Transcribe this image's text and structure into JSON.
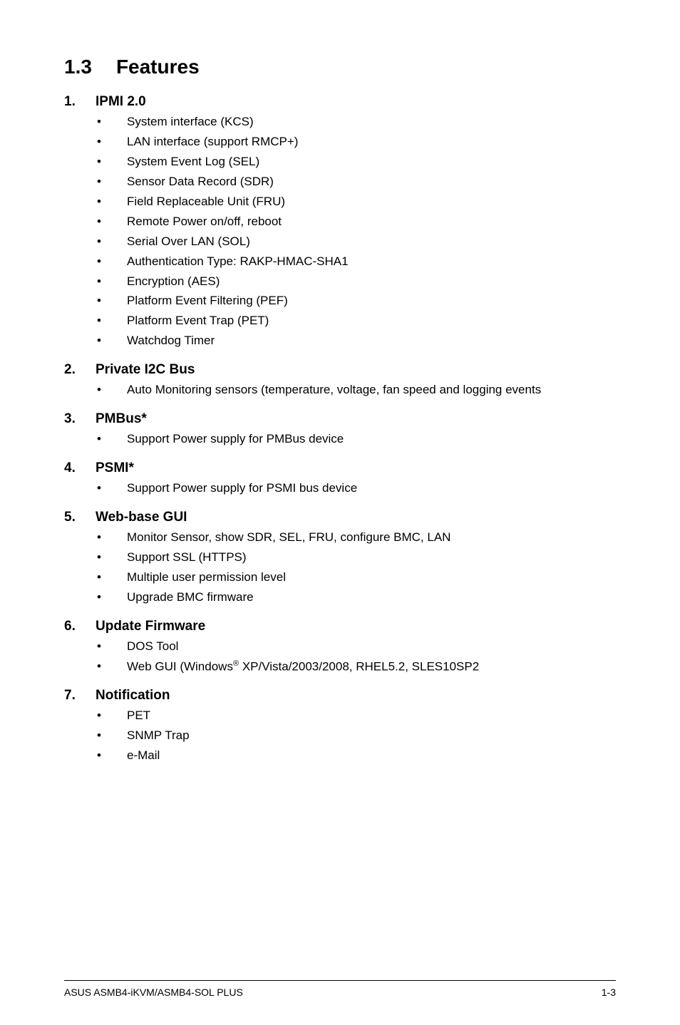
{
  "section": {
    "number": "1.3",
    "title": "Features"
  },
  "items": [
    {
      "num": "1.",
      "title": "IPMI 2.0",
      "subs": [
        "System interface (KCS)",
        "LAN interface (support RMCP+)",
        "System Event Log (SEL)",
        "Sensor Data Record (SDR)",
        "Field Replaceable Unit (FRU)",
        "Remote Power on/off, reboot",
        "Serial Over LAN (SOL)",
        "Authentication Type: RAKP-HMAC-SHA1",
        "Encryption (AES)",
        "Platform Event Filtering (PEF)",
        "Platform Event Trap (PET)",
        "Watchdog Timer"
      ]
    },
    {
      "num": "2.",
      "title": "Private I2C Bus",
      "subs": [
        "Auto Monitoring sensors (temperature, voltage, fan speed and logging events"
      ]
    },
    {
      "num": "3.",
      "title": "PMBus*",
      "subs": [
        "Support Power supply for PMBus device"
      ]
    },
    {
      "num": "4.",
      "title": "PSMI*",
      "subs": [
        "Support Power supply for PSMI bus device"
      ]
    },
    {
      "num": "5.",
      "title": "Web-base GUI",
      "subs": [
        "Monitor Sensor, show SDR, SEL, FRU, configure BMC, LAN",
        "Support SSL (HTTPS)",
        "Multiple user permission level",
        "Upgrade BMC firmware"
      ]
    },
    {
      "num": "6.",
      "title": "Update Firmware",
      "subs": [
        "DOS Tool",
        "Web GUI (Windows® XP/Vista/2003/2008, RHEL5.2, SLES10SP2"
      ]
    },
    {
      "num": "7.",
      "title": "Notification",
      "subs": [
        "PET",
        "SNMP Trap",
        "e-Mail"
      ]
    }
  ],
  "footer": {
    "left": "ASUS ASMB4-iKVM/ASMB4-SOL PLUS",
    "right": "1-3"
  }
}
